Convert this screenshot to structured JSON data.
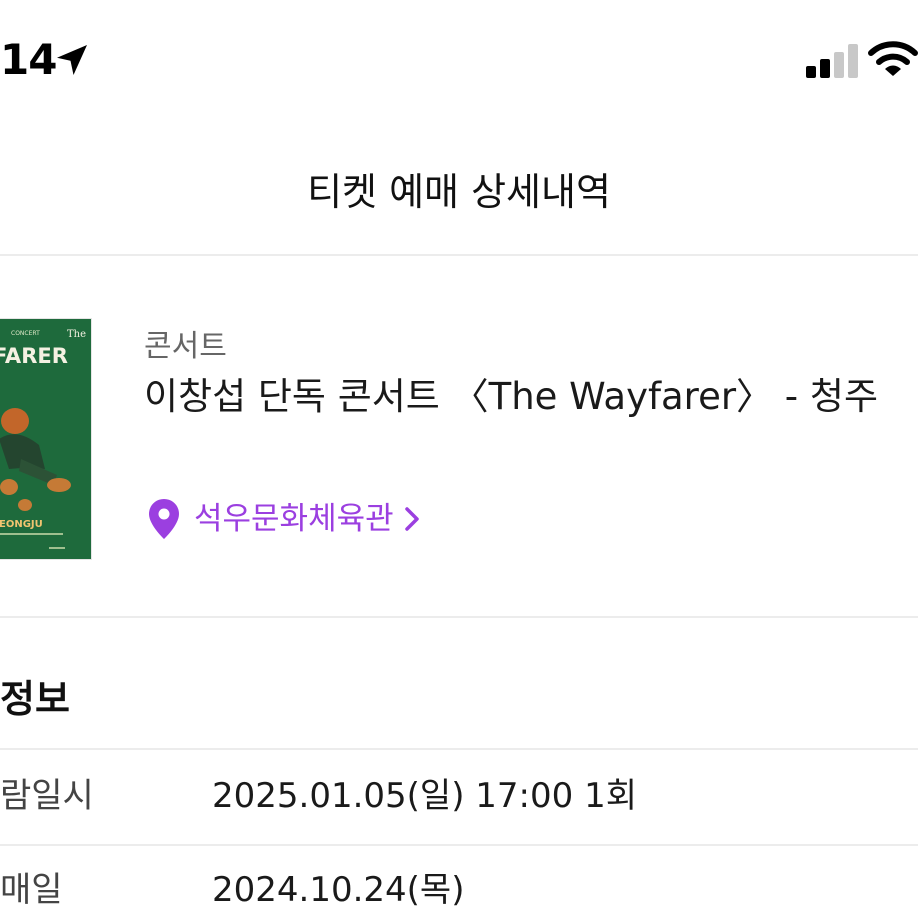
{
  "status_bar": {
    "time": "14",
    "icons": [
      "location-arrow-icon",
      "cellular-signal-icon",
      "wifi-icon"
    ]
  },
  "header": {
    "title": "티켓 예매 상세내역"
  },
  "event": {
    "poster_text": {
      "top_small": "CONCERT",
      "top_right": "The",
      "title_fragment": "FARER",
      "city_fragment": "EONGJU"
    },
    "category": "콘서트",
    "title": "이창섭 단독 콘서트 〈The Wayfarer〉 - 청주",
    "venue": "석우문화체육관",
    "venue_icon": "map-pin-icon",
    "accent_color": "#9b3fe0"
  },
  "booking_info": {
    "section_title": "정보",
    "rows": [
      {
        "label": "람일시",
        "value": "2025.01.05(일) 17:00 1회"
      },
      {
        "label": "매일",
        "value": "2024.10.24(목)"
      }
    ]
  }
}
